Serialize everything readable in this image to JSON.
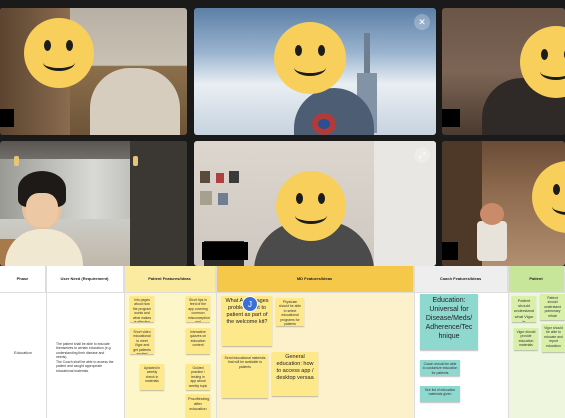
{
  "participants": [
    {
      "avatar": "smiley-face-emoji"
    },
    {
      "avatar": "smiley-face-emoji"
    },
    {
      "avatar": "smiley-face-emoji"
    },
    {
      "avatar": "participant-video"
    },
    {
      "avatar": "smiley-face-emoji"
    },
    {
      "avatar": "smiley-face-emoji"
    }
  ],
  "board": {
    "headers": {
      "phase": "Phase",
      "user_need": "User Need (Requirement)",
      "patient": "Patient Features/Ideas",
      "md": "MD Features/Ideas",
      "coach": "Coach Features/Ideas",
      "patient_extra": "Patient"
    },
    "row_label": "Education",
    "user_need_text": "The patient shall be able to educate themselves to certain education (e.g. understanding their disease and needs).\nThe Coach shall be able to access the patient and caught appropriate educational materials.",
    "patient_stickies": [
      "Info pages about how the program works and what makes is effective",
      "Short tips in feed of the app covering common misconceptions and questions",
      "Short video educational to meet Vigor and get patients excited",
      "Interactive quizzes on education content",
      "Updated in weekly check in materials",
      "Guided practice / testing in app about weekly topic",
      "Prooftesting after education"
    ],
    "md_stickies": [
      "What Advantages problem sent to patient as part of the welcome kit?",
      "Physician should be able to select educational programs for patients",
      "Send educational materials that will be available to patients",
      "General education: how to access app / desktop versaa"
    ],
    "md_avatar": "J",
    "coach_sticky": "Education: Universal for Disease/Meds/ Adherence/Tec hnique",
    "coach_small_stickies": [
      "Coach should be able to customize education for patients",
      "See list of education materials given"
    ],
    "patient_extra_stickies": [
      "Patient should understand what Vigor is",
      "Patient should understand pulmonary rehab",
      "Vigor should be able to educate and report education",
      "Vigor should provide education materials"
    ],
    "colors": {
      "patient": "#fdf6c8",
      "patient_head": "#fbeba0",
      "md_head": "#f5c84a",
      "coach_head": "#eeeeee",
      "patient_extra_head": "#c8e69a",
      "yellow_sticky": "#fde98a",
      "teal_sticky": "#8fd8d0",
      "green_sticky": "#d8f0a8"
    }
  }
}
